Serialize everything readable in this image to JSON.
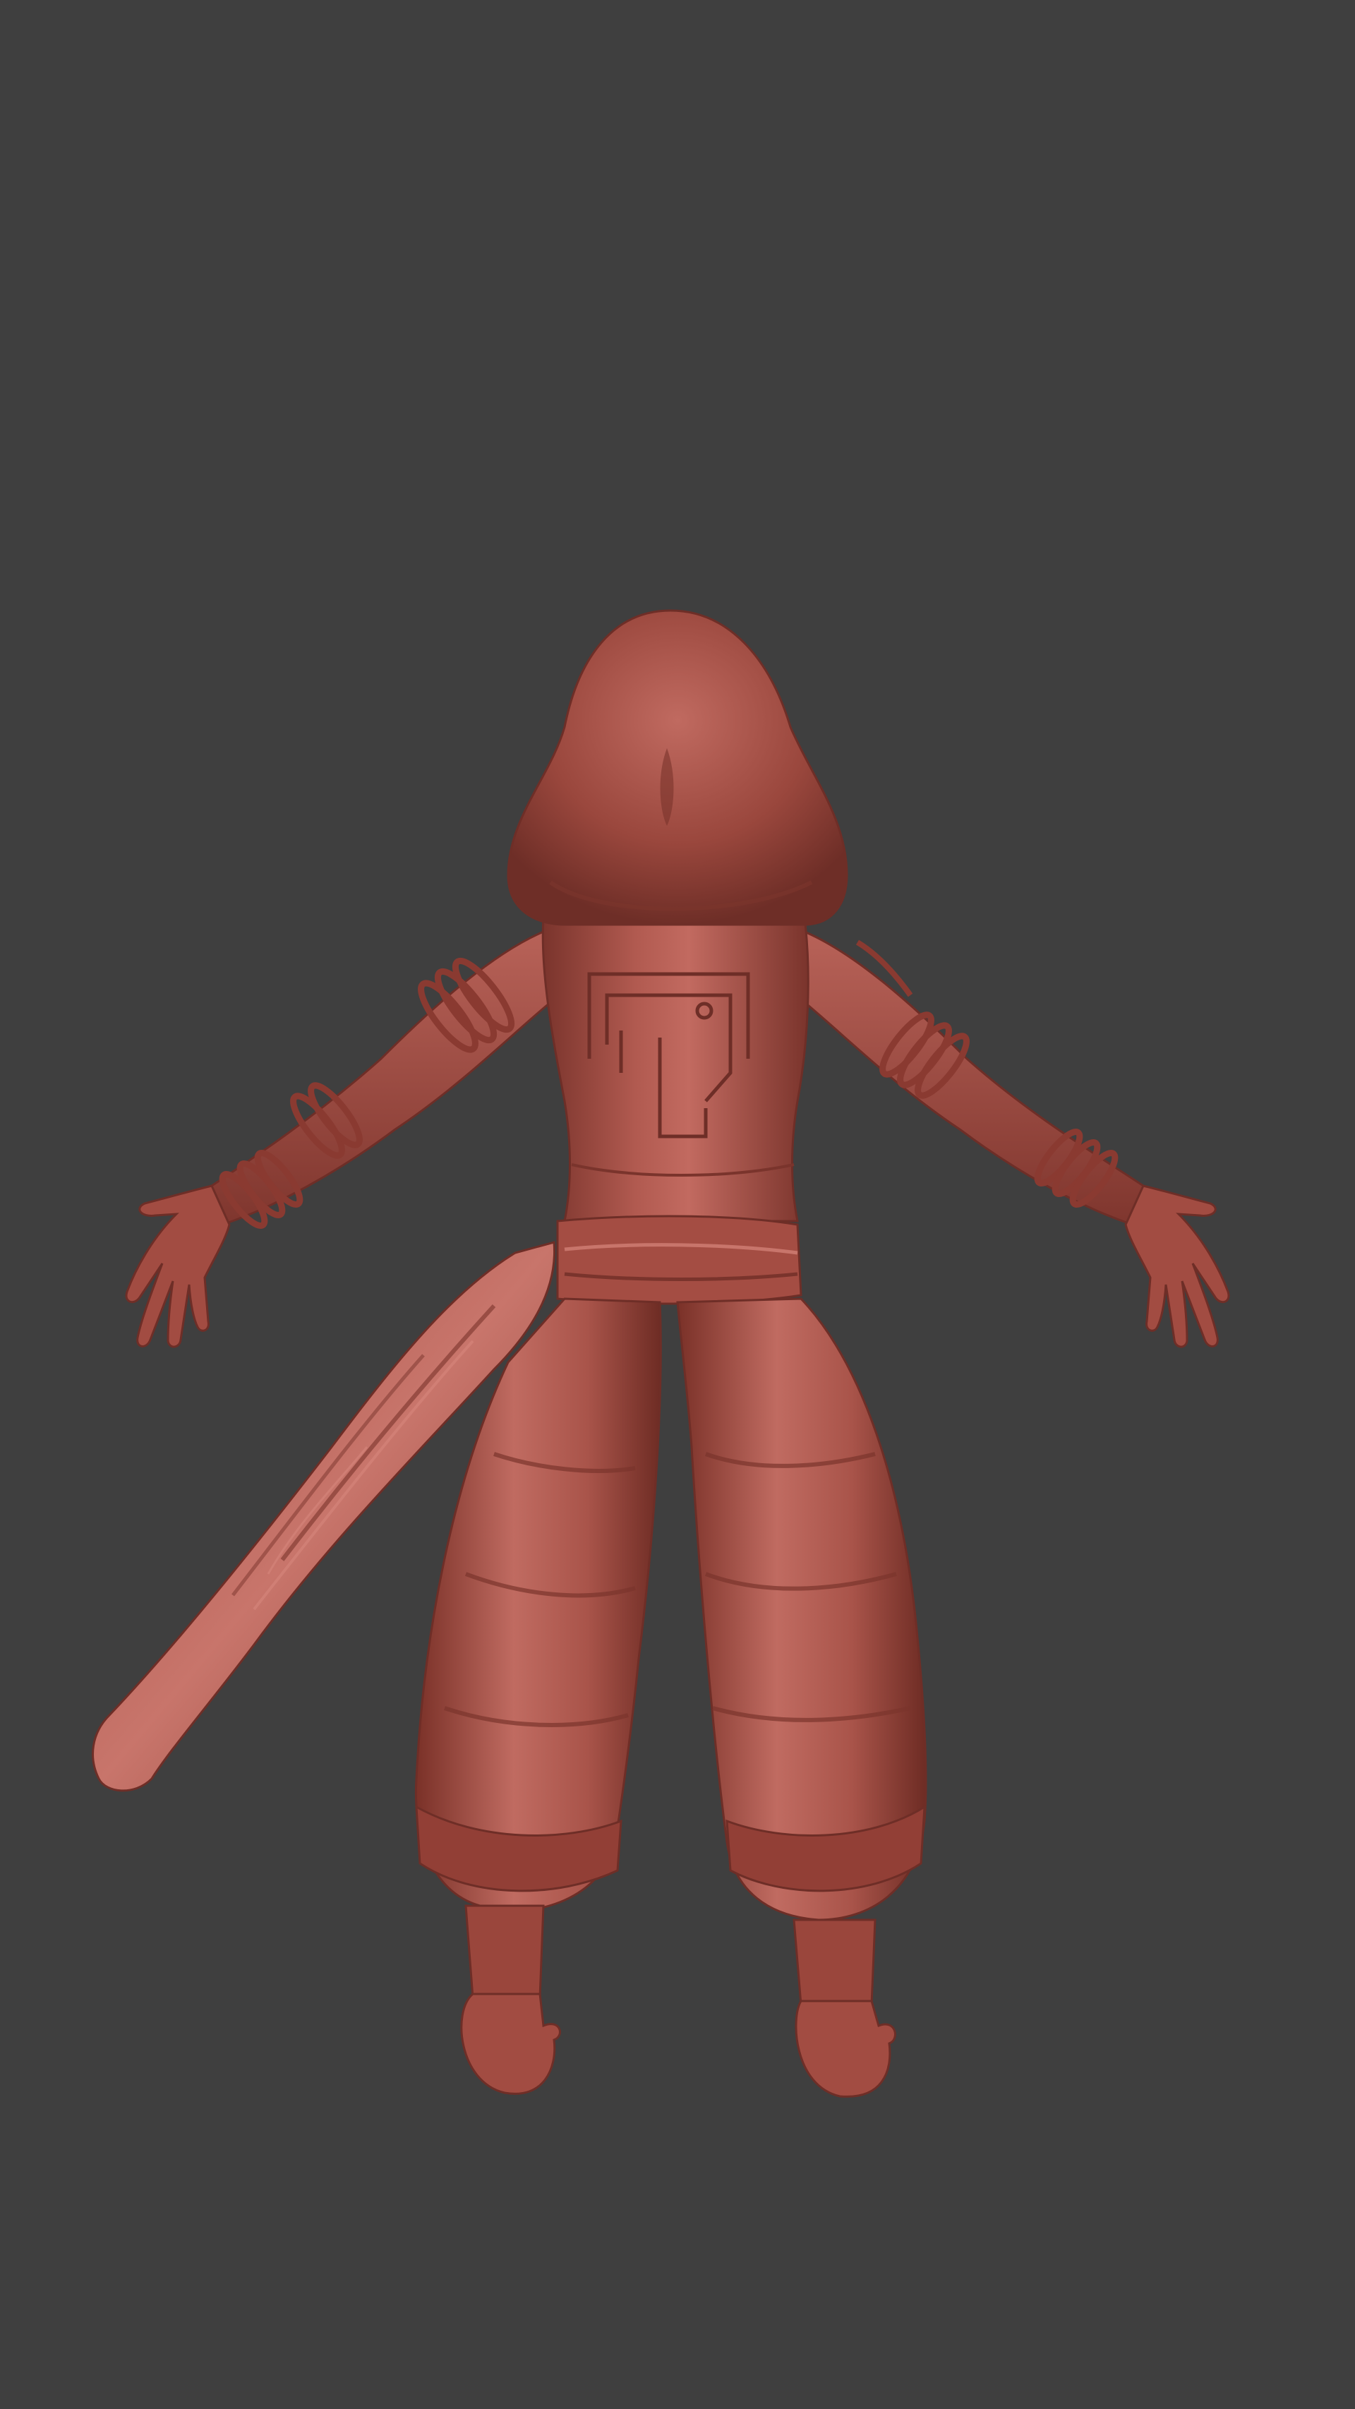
{
  "scene": {
    "background_color": "#3f3f3f",
    "material_color": "#9c4a40",
    "material_highlight": "#c7736a",
    "material_shadow": "#6e2e27",
    "view": "back",
    "pose": "T-pose",
    "subject": "hooded-character-sculpt"
  }
}
